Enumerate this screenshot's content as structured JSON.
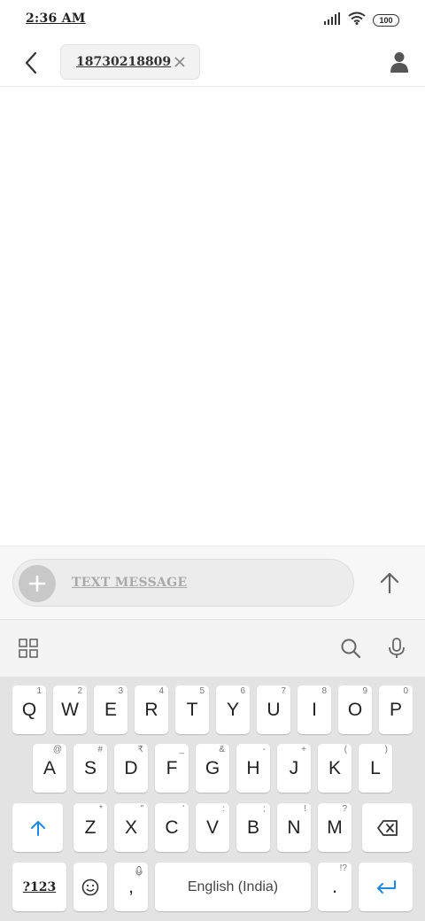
{
  "status": {
    "time": "2:36 AM",
    "battery": "100"
  },
  "header": {
    "recipient": "18730218809"
  },
  "composer": {
    "placeholder": "TEXT MESSAGE"
  },
  "keyboard": {
    "row1": [
      {
        "label": "Q",
        "hint": "1"
      },
      {
        "label": "W",
        "hint": "2"
      },
      {
        "label": "E",
        "hint": "3"
      },
      {
        "label": "R",
        "hint": "4"
      },
      {
        "label": "T",
        "hint": "5"
      },
      {
        "label": "Y",
        "hint": "6"
      },
      {
        "label": "U",
        "hint": "7"
      },
      {
        "label": "I",
        "hint": "8"
      },
      {
        "label": "O",
        "hint": "9"
      },
      {
        "label": "P",
        "hint": "0"
      }
    ],
    "row2": [
      {
        "label": "A",
        "hint": "@"
      },
      {
        "label": "S",
        "hint": "#"
      },
      {
        "label": "D",
        "hint": "₹"
      },
      {
        "label": "F",
        "hint": "_"
      },
      {
        "label": "G",
        "hint": "&"
      },
      {
        "label": "H",
        "hint": "-"
      },
      {
        "label": "J",
        "hint": "+"
      },
      {
        "label": "K",
        "hint": "("
      },
      {
        "label": "L",
        "hint": ")"
      }
    ],
    "row3": [
      {
        "label": "Z",
        "hint": "*"
      },
      {
        "label": "X",
        "hint": "\""
      },
      {
        "label": "C",
        "hint": "'"
      },
      {
        "label": "V",
        "hint": ":"
      },
      {
        "label": "B",
        "hint": ";"
      },
      {
        "label": "N",
        "hint": "!"
      },
      {
        "label": "M",
        "hint": "?"
      }
    ],
    "num_sym": "?123",
    "comma": ",",
    "space": "English (India)",
    "period": ".",
    "period_hint": "!?"
  },
  "colors": {
    "accent": "#1e88e5"
  }
}
